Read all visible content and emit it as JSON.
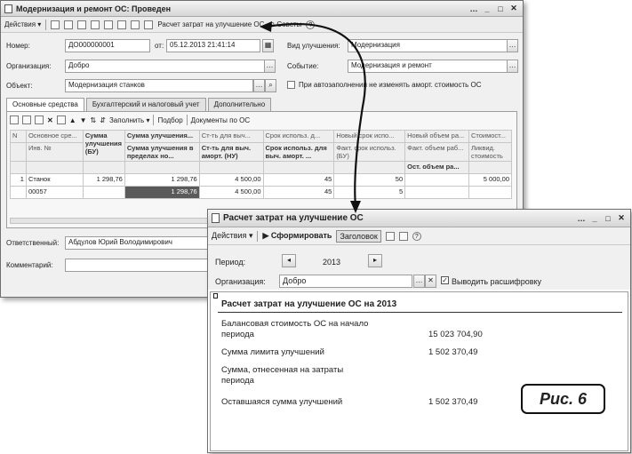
{
  "doc_window": {
    "title": "Модернизация и ремонт ОС: Проведен",
    "toolbar": {
      "actions_label": "Действия",
      "report_link": "Расчет затрат на улучшение ОС",
      "tips_label": "Советы"
    },
    "number_label": "Номер:",
    "number_value": "ДО000000001",
    "date_label": "от:",
    "date_value": "05.12.2013 21:41:14",
    "org_label": "Организация:",
    "org_value": "Добро",
    "object_label": "Объект:",
    "object_value": "Модернизация станков",
    "kind_label": "Вид улучшения:",
    "kind_value": "Модернизация",
    "event_label": "Событие:",
    "event_value": "Модернизация и ремонт",
    "checkbox_label": "При автозаполнении не изменять аморт. стоимость ОС",
    "tabs": [
      "Основные средства",
      "Бухгалтерский и налоговый учет",
      "Дополнительно"
    ],
    "table_toolbar": {
      "fill_label": "Заполнить",
      "select_label": "Подбор",
      "docs_label": "Документы по ОС"
    },
    "table": {
      "head1": [
        "N",
        "Основное сре...",
        "Сумма улучшения (БУ)",
        "Сумма улучшения...",
        "Ст-ть для выч...",
        "Срок использ. д...",
        "Новый срок испо...",
        "Новый объем ра...",
        "Стоимост..."
      ],
      "head2": [
        "",
        "Инв. №",
        "",
        "Сумма улучшения в пределах но...",
        "Ст-ть для выч. аморт. (НУ)",
        "Срок использ. для выч. аморт. ...",
        "Факт. срок использ. (БУ)",
        "Факт. объем раб...",
        "Ликвид. стоимость"
      ],
      "head3": [
        "",
        "",
        "",
        "",
        "",
        "",
        "",
        "Ост. объем ра...",
        ""
      ],
      "row1": [
        "1",
        "Станок",
        "1 298,76",
        "1 298,76",
        "4 500,00",
        "45",
        "50",
        "",
        "5 000,00"
      ],
      "row2": [
        "",
        "00057",
        "",
        "1 298,76",
        "4 500,00",
        "45",
        "5",
        "",
        ""
      ]
    },
    "responsible_label": "Ответственный:",
    "responsible_value": "Абдулов Юрий Володимирович",
    "comment_label": "Комментарий:"
  },
  "report_window": {
    "title": "Расчет затрат на улучшение ОС",
    "toolbar": {
      "actions_label": "Действия",
      "form_label": "Сформировать",
      "header_label": "Заголовок"
    },
    "period_label": "Период:",
    "period_value": "2013",
    "org_label": "Организация:",
    "org_value": "Добро",
    "decode_label": "Выводить расшифровку",
    "report_title": "Расчет затрат на улучшение ОС на 2013",
    "rows": [
      {
        "label": "Балансовая стоимость ОС на начало периода",
        "value": "15 023 704,90"
      },
      {
        "label": "Сумма лимита улучшений",
        "value": "1 502 370,49"
      },
      {
        "label": "Сумма, отнесенная на затраты периода",
        "value": ""
      },
      {
        "label": "Оставшаяся сумма улучшений",
        "value": "1 502 370,49"
      }
    ]
  },
  "figure_label": "Рис. 6"
}
